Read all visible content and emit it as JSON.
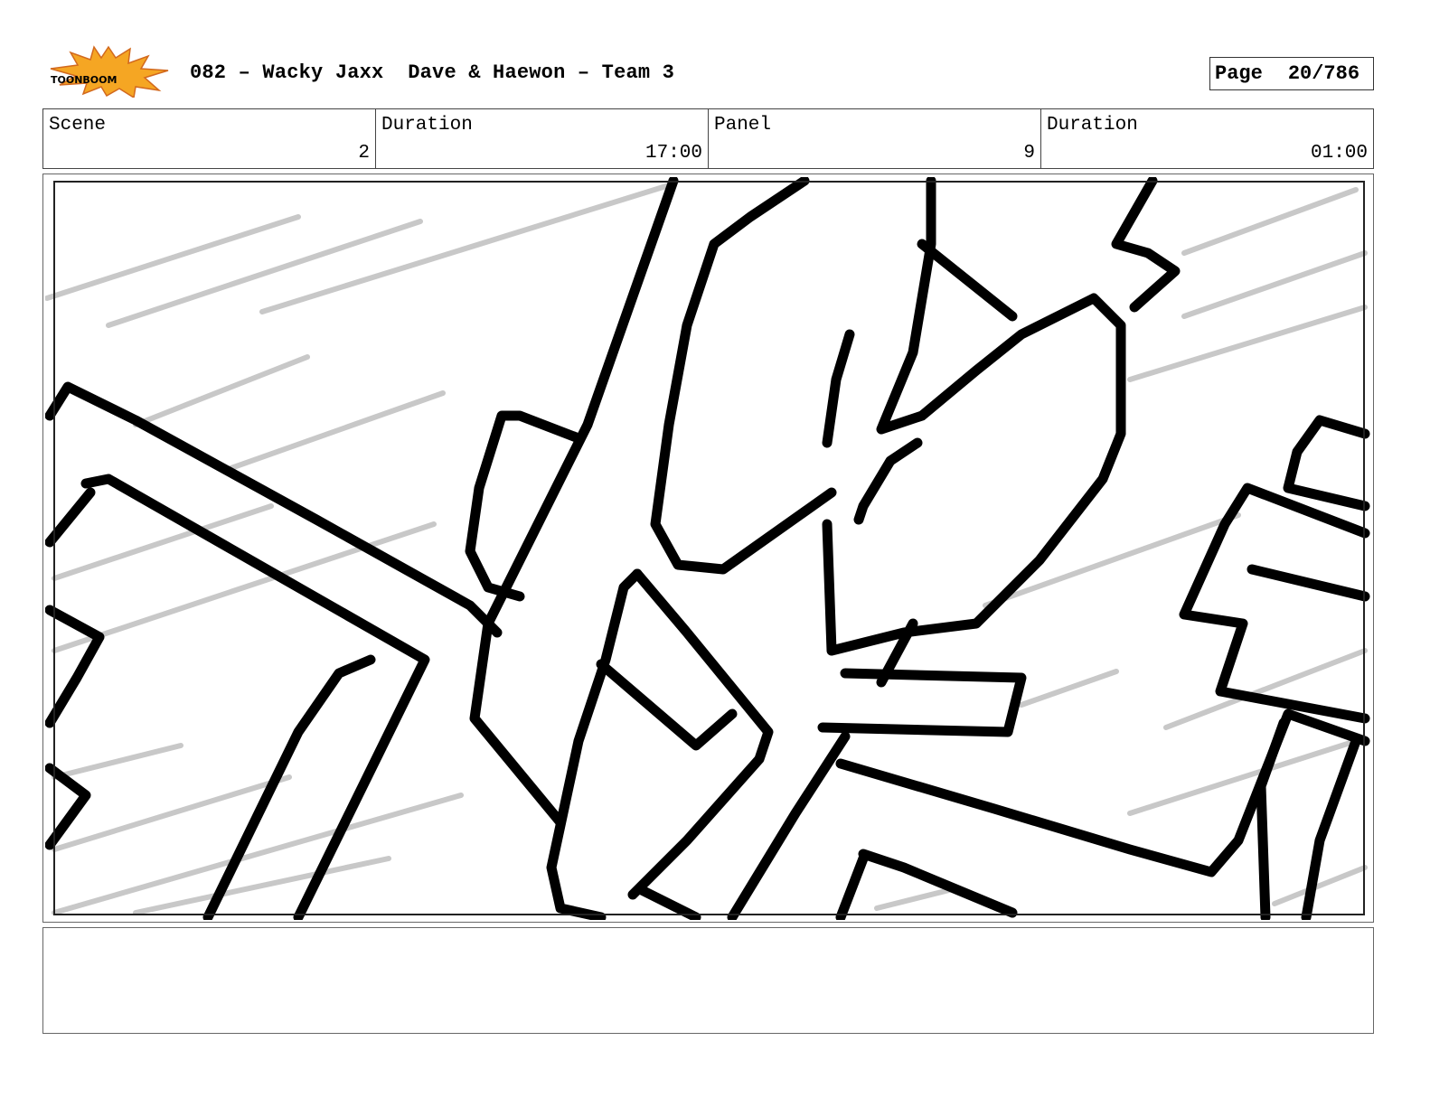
{
  "header": {
    "logo_text": "TOONBOOM",
    "title": "082 – Wacky Jaxx  Dave & Haewon – Team 3",
    "page_label": "Page",
    "page_value": "20/786"
  },
  "info": {
    "scene_label": "Scene",
    "scene_value": "2",
    "scene_duration_label": "Duration",
    "scene_duration_value": "17:00",
    "panel_label": "Panel",
    "panel_value": "9",
    "panel_duration_label": "Duration",
    "panel_duration_value": "01:00"
  },
  "notes": {
    "text": ""
  }
}
